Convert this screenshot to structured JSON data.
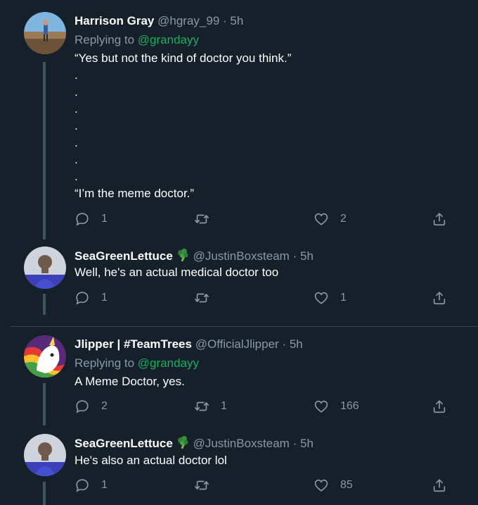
{
  "tweets": [
    {
      "name": "Harrison Gray",
      "handle": "@hgray_99",
      "sep": "·",
      "time": "5h",
      "replying_prefix": "Replying to",
      "replying_to": "@grandayy",
      "lines": [
        "“Yes but not the kind of doctor you think.”",
        ".",
        ".",
        ".",
        ".",
        ".",
        ".",
        ".",
        "“I’m the meme doctor.”"
      ],
      "replies": "1",
      "retweets": "",
      "likes": "2"
    },
    {
      "name": "SeaGreenLettuce",
      "handle": "@JustinBoxsteam",
      "sep": "·",
      "time": "5h",
      "text": "Well, he's an actual medical doctor too",
      "replies": "1",
      "retweets": "",
      "likes": "1"
    },
    {
      "name": "Jlipper | #TeamTrees",
      "handle": "@OfficialJlipper",
      "sep": "·",
      "time": "5h",
      "replying_prefix": "Replying to",
      "replying_to": "@grandayy",
      "text": "A Meme Doctor, yes.",
      "replies": "2",
      "retweets": "1",
      "likes": "166"
    },
    {
      "name": "SeaGreenLettuce",
      "handle": "@JustinBoxsteam",
      "sep": "·",
      "time": "5h",
      "text": "He's also an actual doctor lol",
      "replies": "1",
      "retweets": "",
      "likes": "85"
    }
  ],
  "icons": {
    "reply": "reply-icon",
    "retweet": "retweet-icon",
    "like": "heart-icon",
    "share": "share-icon",
    "emoji": "broccoli-emoji"
  },
  "colors": {
    "background": "#15202b",
    "mention": "#1bad5f",
    "secondary_text": "#8899a6",
    "thread_line": "#3d5466"
  }
}
